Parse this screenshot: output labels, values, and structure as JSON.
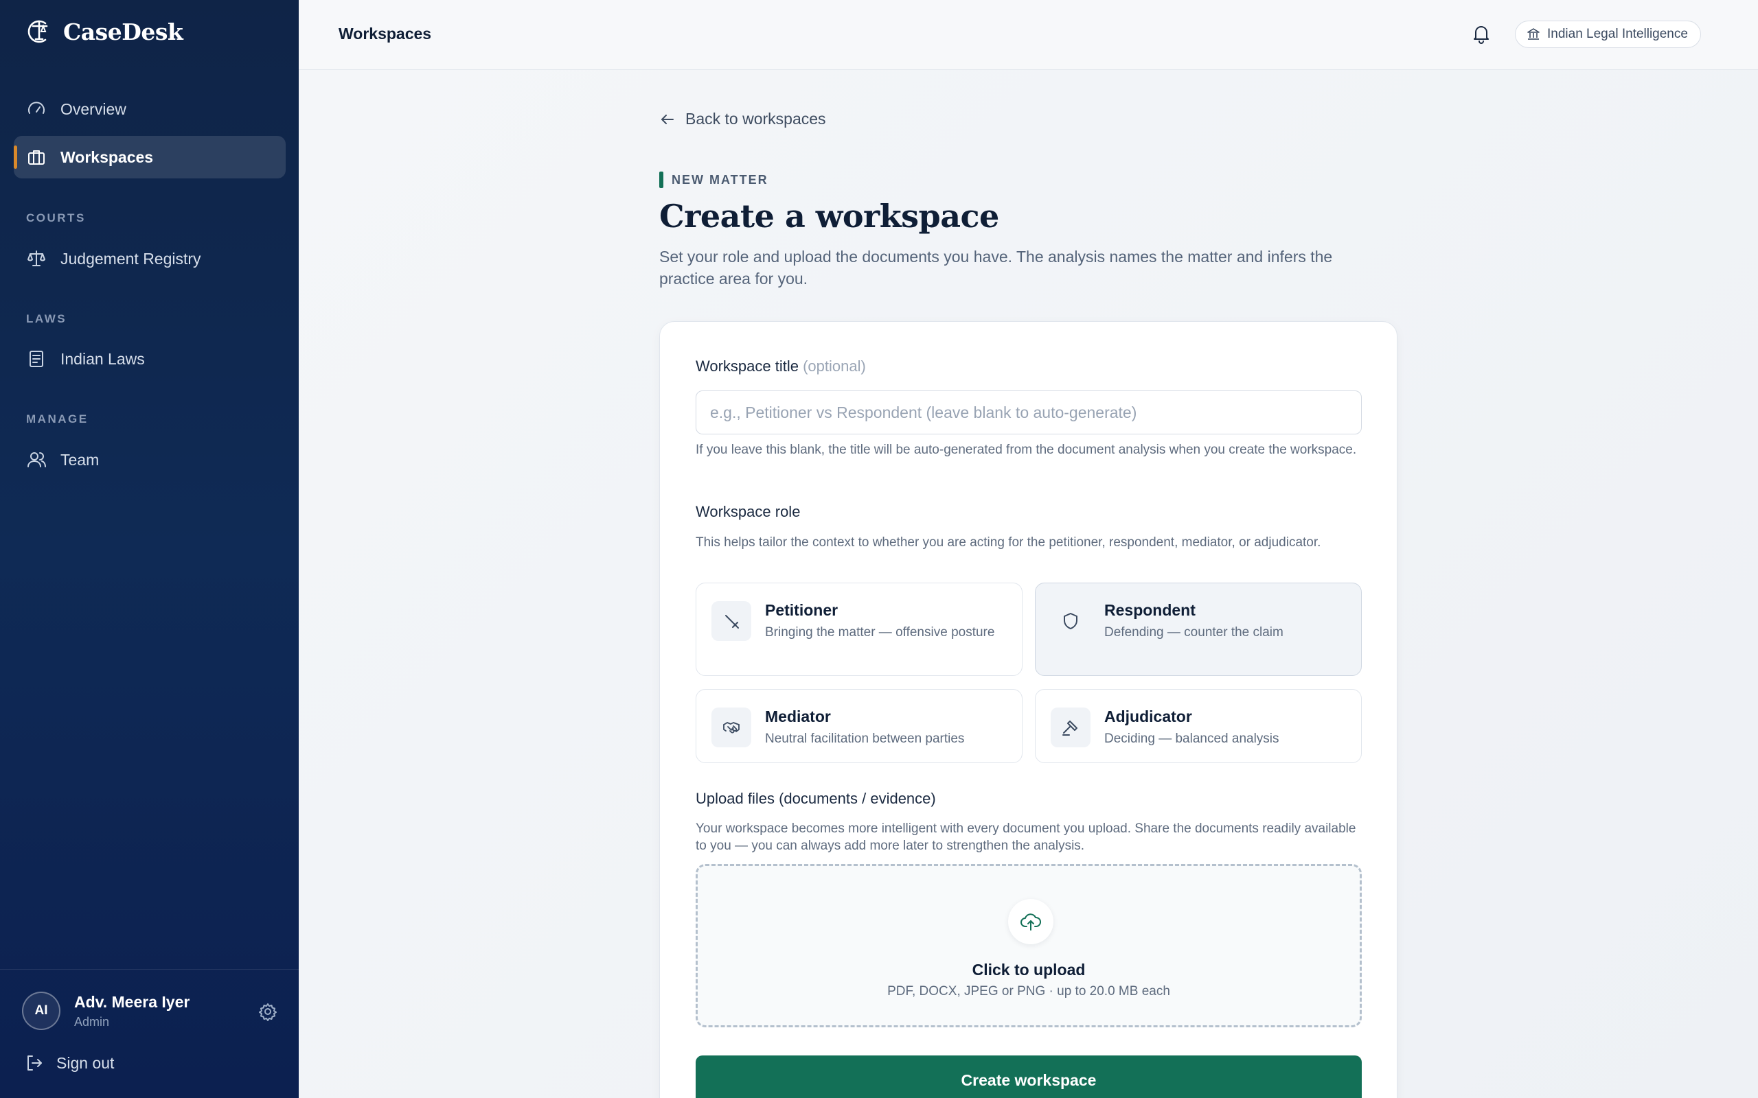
{
  "app": {
    "name": "CaseDesk"
  },
  "sidebar": {
    "nav": [
      {
        "label": "Overview",
        "icon": "gauge-icon"
      },
      {
        "label": "Workspaces",
        "icon": "briefcase-icon",
        "active": true
      }
    ],
    "sections": [
      {
        "title": "COURTS",
        "items": [
          {
            "label": "Judgement Registry",
            "icon": "scales-icon"
          }
        ]
      },
      {
        "title": "LAWS",
        "items": [
          {
            "label": "Indian Laws",
            "icon": "document-icon"
          }
        ]
      },
      {
        "title": "MANAGE",
        "items": [
          {
            "label": "Team",
            "icon": "users-icon"
          }
        ]
      }
    ],
    "user": {
      "initials": "AI",
      "name": "Adv. Meera Iyer",
      "role": "Admin"
    },
    "signout_label": "Sign out",
    "active_indicator_color": "#d9892b"
  },
  "header": {
    "title": "Workspaces",
    "org_label": "Indian Legal Intelligence"
  },
  "page": {
    "back_label": "Back to workspaces",
    "eyebrow": "NEW MATTER",
    "title": "Create a workspace",
    "subtitle": "Set your role and upload the documents you have. The analysis names the matter and infers the practice area for you."
  },
  "form": {
    "title_label": "Workspace title",
    "title_optional": "(optional)",
    "title_value": "",
    "title_placeholder": "e.g., Petitioner vs Respondent (leave blank to auto-generate)",
    "title_help": "If you leave this blank, the title will be auto-generated from the document analysis when you create the workspace.",
    "role_label": "Workspace role",
    "role_help": "This helps tailor the context to whether you are acting for the petitioner, respondent, mediator, or adjudicator.",
    "roles": [
      {
        "name": "Petitioner",
        "desc": "Bringing the matter — offensive posture",
        "icon": "sword-icon",
        "selected": false
      },
      {
        "name": "Respondent",
        "desc": "Defending — counter the claim",
        "icon": "shield-icon",
        "selected": true
      },
      {
        "name": "Mediator",
        "desc": "Neutral facilitation between parties",
        "icon": "handshake-icon",
        "selected": false
      },
      {
        "name": "Adjudicator",
        "desc": "Deciding — balanced analysis",
        "icon": "gavel-icon",
        "selected": false
      }
    ],
    "upload_label": "Upload files (documents / evidence)",
    "upload_help": "Your workspace becomes more intelligent with every document you upload. Share the documents readily available to you — you can always add more later to strengthen the analysis.",
    "upload_title": "Click to upload",
    "upload_sub": "PDF, DOCX, JPEG or PNG · up to 20.0 MB each",
    "submit_label": "Create workspace",
    "accent_color": "#137057"
  }
}
